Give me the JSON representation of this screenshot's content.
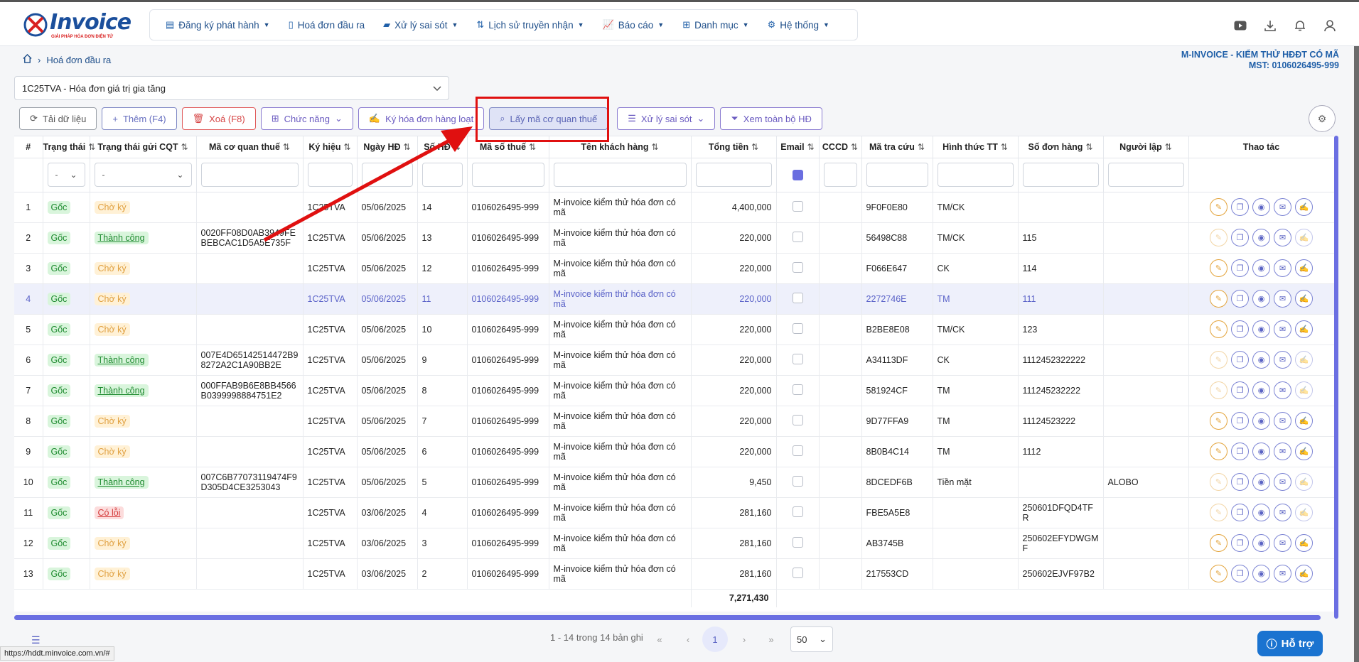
{
  "app": {
    "logo_text": "Invoice",
    "logo_tagline": "GIẢI PHÁP HÓA ĐƠN ĐIỆN TỬ"
  },
  "nav": [
    {
      "label": "Đăng ký phát hành",
      "icon": "document-icon"
    },
    {
      "label": "Hoá đơn đầu ra",
      "icon": "file-icon"
    },
    {
      "label": "Xử lý sai sót",
      "icon": "folder-icon"
    },
    {
      "label": "Lịch sử truyền nhận",
      "icon": "transfer-icon"
    },
    {
      "label": "Báo cáo",
      "icon": "chart-icon"
    },
    {
      "label": "Danh mục",
      "icon": "grid-icon"
    },
    {
      "label": "Hệ thống",
      "icon": "gear-icon"
    }
  ],
  "breadcrumb": {
    "current": "Hoá đơn đầu ra"
  },
  "company": {
    "name": "M-INVOICE - KIỂM THỬ HĐĐT CÓ MÃ",
    "tax": "MST: 0106026495-999"
  },
  "invoice_type": {
    "selected": "1C25TVA - Hóa đơn giá trị gia tăng"
  },
  "toolbar": {
    "reload": "Tải dữ liệu",
    "add": "Thêm (F4)",
    "delete": "Xoá (F8)",
    "functions": "Chức năng",
    "bulk_sign": "Ký hóa đơn hàng loạt",
    "get_tax_code": "Lấy mã cơ quan thuế",
    "handle_errors": "Xử lý sai sót",
    "view_all": "Xem toàn bộ HĐ"
  },
  "columns": [
    "#",
    "Trạng thái",
    "Trạng thái gửi CQT",
    "Mã cơ quan thuế",
    "Ký hiệu",
    "Ngày HĐ",
    "Số HĐ",
    "Mã số thuế",
    "Tên khách hàng",
    "Tổng tiền",
    "Email",
    "CCCD",
    "Mã tra cứu",
    "Hình thức TT",
    "Số đơn hàng",
    "Người lập",
    "Thao tác"
  ],
  "filters": {
    "status": "-",
    "send_status": "-"
  },
  "rows": [
    {
      "no": "1",
      "status": "Gốc",
      "send": "Chờ ký",
      "send_type": "cho",
      "tax_code": "",
      "symbol": "1C25TVA",
      "date": "05/06/2025",
      "num": "14",
      "mst": "0106026495-999",
      "customer": "M-invoice kiểm thử hóa đơn có mã",
      "total": "4,400,000",
      "lookup": "9F0F0E80",
      "payment": "TM/CK",
      "order": "",
      "creator": "",
      "actions_disabled": false
    },
    {
      "no": "2",
      "status": "Gốc",
      "send": "Thành công",
      "send_type": "tc",
      "tax_code": "0020FF08D0AB3949FEBEBCAC1D5A5E735F",
      "symbol": "1C25TVA",
      "date": "05/06/2025",
      "num": "13",
      "mst": "0106026495-999",
      "customer": "M-invoice kiểm thử hóa đơn có mã",
      "total": "220,000",
      "lookup": "56498C88",
      "payment": "TM/CK",
      "order": "115",
      "creator": "",
      "actions_disabled": true
    },
    {
      "no": "3",
      "status": "Gốc",
      "send": "Chờ ký",
      "send_type": "cho",
      "tax_code": "",
      "symbol": "1C25TVA",
      "date": "05/06/2025",
      "num": "12",
      "mst": "0106026495-999",
      "customer": "M-invoice kiểm thử hóa đơn có mã",
      "total": "220,000",
      "lookup": "F066E647",
      "payment": "CK",
      "order": "114",
      "creator": "",
      "actions_disabled": false
    },
    {
      "no": "4",
      "status": "Gốc",
      "send": "Chờ ký",
      "send_type": "cho",
      "tax_code": "",
      "symbol": "1C25TVA",
      "date": "05/06/2025",
      "num": "11",
      "mst": "0106026495-999",
      "customer": "M-invoice kiểm thử hóa đơn có mã",
      "total": "220,000",
      "lookup": "2272746E",
      "payment": "TM",
      "order": "111",
      "creator": "",
      "actions_disabled": false,
      "selected": true
    },
    {
      "no": "5",
      "status": "Gốc",
      "send": "Chờ ký",
      "send_type": "cho",
      "tax_code": "",
      "symbol": "1C25TVA",
      "date": "05/06/2025",
      "num": "10",
      "mst": "0106026495-999",
      "customer": "M-invoice kiểm thử hóa đơn có mã",
      "total": "220,000",
      "lookup": "B2BE8E08",
      "payment": "TM/CK",
      "order": "123",
      "creator": "",
      "actions_disabled": false
    },
    {
      "no": "6",
      "status": "Gốc",
      "send": "Thành công",
      "send_type": "tc",
      "tax_code": "007E4D65142514472B98272A2C1A90BB2E",
      "symbol": "1C25TVA",
      "date": "05/06/2025",
      "num": "9",
      "mst": "0106026495-999",
      "customer": "M-invoice kiểm thử hóa đơn có mã",
      "total": "220,000",
      "lookup": "A34113DF",
      "payment": "CK",
      "order": "1112452322222",
      "creator": "",
      "actions_disabled": true
    },
    {
      "no": "7",
      "status": "Gốc",
      "send": "Thành công",
      "send_type": "tc",
      "tax_code": "000FFAB9B6E8BB4566B0399998884751E2",
      "symbol": "1C25TVA",
      "date": "05/06/2025",
      "num": "8",
      "mst": "0106026495-999",
      "customer": "M-invoice kiểm thử hóa đơn có mã",
      "total": "220,000",
      "lookup": "581924CF",
      "payment": "TM",
      "order": "111245232222",
      "creator": "",
      "actions_disabled": true
    },
    {
      "no": "8",
      "status": "Gốc",
      "send": "Chờ ký",
      "send_type": "cho",
      "tax_code": "",
      "symbol": "1C25TVA",
      "date": "05/06/2025",
      "num": "7",
      "mst": "0106026495-999",
      "customer": "M-invoice kiểm thử hóa đơn có mã",
      "total": "220,000",
      "lookup": "9D77FFA9",
      "payment": "TM",
      "order": "11124523222",
      "creator": "",
      "actions_disabled": false
    },
    {
      "no": "9",
      "status": "Gốc",
      "send": "Chờ ký",
      "send_type": "cho",
      "tax_code": "",
      "symbol": "1C25TVA",
      "date": "05/06/2025",
      "num": "6",
      "mst": "0106026495-999",
      "customer": "M-invoice kiểm thử hóa đơn có mã",
      "total": "220,000",
      "lookup": "8B0B4C14",
      "payment": "TM",
      "order": "1112",
      "creator": "",
      "actions_disabled": false
    },
    {
      "no": "10",
      "status": "Gốc",
      "send": "Thành công",
      "send_type": "tc",
      "tax_code": "007C6B77073119474F9D305D4CE3253043",
      "symbol": "1C25TVA",
      "date": "05/06/2025",
      "num": "5",
      "mst": "0106026495-999",
      "customer": "M-invoice kiểm thử hóa đơn có mã",
      "total": "9,450",
      "lookup": "8DCEDF6B",
      "payment": "Tiền mặt",
      "order": "",
      "creator": "ALOBO",
      "actions_disabled": true
    },
    {
      "no": "11",
      "status": "Gốc",
      "send": "Có lỗi",
      "send_type": "loi",
      "tax_code": "",
      "symbol": "1C25TVA",
      "date": "03/06/2025",
      "num": "4",
      "mst": "0106026495-999",
      "customer": "M-invoice kiểm thử hóa đơn có mã",
      "total": "281,160",
      "lookup": "FBE5A5E8",
      "payment": "",
      "order": "250601DFQD4TFR",
      "creator": "",
      "actions_disabled": true
    },
    {
      "no": "12",
      "status": "Gốc",
      "send": "Chờ ký",
      "send_type": "cho",
      "tax_code": "",
      "symbol": "1C25TVA",
      "date": "03/06/2025",
      "num": "3",
      "mst": "0106026495-999",
      "customer": "M-invoice kiểm thử hóa đơn có mã",
      "total": "281,160",
      "lookup": "AB3745B",
      "payment": "",
      "order": "250602EFYDWGMF",
      "creator": "",
      "actions_disabled": false
    },
    {
      "no": "13",
      "status": "Gốc",
      "send": "Chờ ký",
      "send_type": "cho",
      "tax_code": "",
      "symbol": "1C25TVA",
      "date": "03/06/2025",
      "num": "2",
      "mst": "0106026495-999",
      "customer": "M-invoice kiểm thử hóa đơn có mã",
      "total": "281,160",
      "lookup": "217553CD",
      "payment": "",
      "order": "250602EJVF97B2",
      "creator": "",
      "actions_disabled": false
    }
  ],
  "footer_total": "7,271,430",
  "pagination": {
    "info": "1 - 14 trong 14 bản ghi",
    "current": "1",
    "page_size": "50"
  },
  "support": {
    "label": "Hỗ trợ"
  },
  "status_url": "https://hddt.minvoice.com.vn/#",
  "colors": {
    "accent": "#6b6fe2",
    "nav_text": "#1f4f8a",
    "highlight_box": "#e01010"
  }
}
